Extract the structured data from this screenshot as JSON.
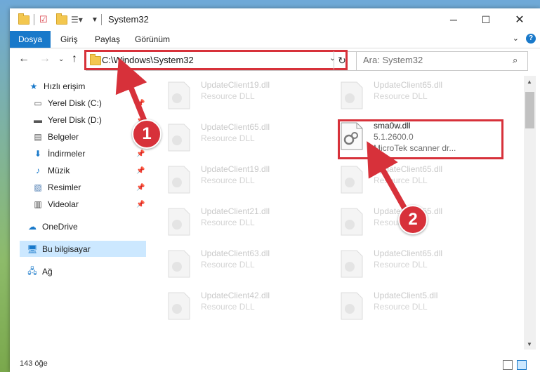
{
  "window": {
    "title": "System32"
  },
  "ribbon": {
    "tabs": [
      "Dosya",
      "Giriş",
      "Paylaş",
      "Görünüm"
    ]
  },
  "address": {
    "path": "C:\\Windows\\System32"
  },
  "search": {
    "placeholder": "Ara: System32"
  },
  "sidebar": {
    "items": [
      {
        "label": "Hızlı erişim",
        "icon": "star-icon"
      },
      {
        "label": "Yerel Disk (C:)",
        "icon": "drive-icon"
      },
      {
        "label": "Yerel Disk (D:)",
        "icon": "drive-icon"
      },
      {
        "label": "Belgeler",
        "icon": "documents-icon"
      },
      {
        "label": "İndirmeler",
        "icon": "download-icon"
      },
      {
        "label": "Müzik",
        "icon": "music-icon"
      },
      {
        "label": "Resimler",
        "icon": "pictures-icon"
      },
      {
        "label": "Videolar",
        "icon": "videos-icon"
      },
      {
        "label": "OneDrive",
        "icon": "cloud-icon"
      },
      {
        "label": "Bu bilgisayar",
        "icon": "computer-icon"
      },
      {
        "label": "Ağ",
        "icon": "network-icon"
      }
    ]
  },
  "files": {
    "left": [
      {
        "name": "UpdateClient19.dll",
        "desc": "Resource DLL"
      },
      {
        "name": "UpdateClient65.dll",
        "desc": "Resource DLL"
      },
      {
        "name": "UpdateClient19.dll",
        "desc": "Resource DLL"
      },
      {
        "name": "UpdateClient21.dll",
        "desc": "Resource DLL"
      },
      {
        "name": "UpdateClient63.dll",
        "desc": "Resource DLL"
      },
      {
        "name": "UpdateClient42.dll",
        "desc": "Resource DLL"
      }
    ],
    "right": [
      {
        "name": "UpdateClient65.dll",
        "desc": "Resource DLL"
      },
      {
        "name": "UpdateClient65.dll",
        "desc": "Resource DLL"
      },
      {
        "name": "UpdateClient65.dll",
        "desc": "Resource DLL"
      },
      {
        "name": "UpdateClient65.dll",
        "desc": "Resource DLL"
      },
      {
        "name": "UpdateClient5.dll",
        "desc": "Resource DLL"
      }
    ],
    "highlighted": {
      "name": "sma0w.dll",
      "version": "5.1.2600.0",
      "desc": "MicroTek scanner dr..."
    }
  },
  "status": {
    "count": "143 öğe"
  },
  "annotations": {
    "step1": "1",
    "step2": "2"
  },
  "colors": {
    "accent": "#1979ca",
    "highlight": "#d7313a",
    "selection": "#cce8ff"
  }
}
